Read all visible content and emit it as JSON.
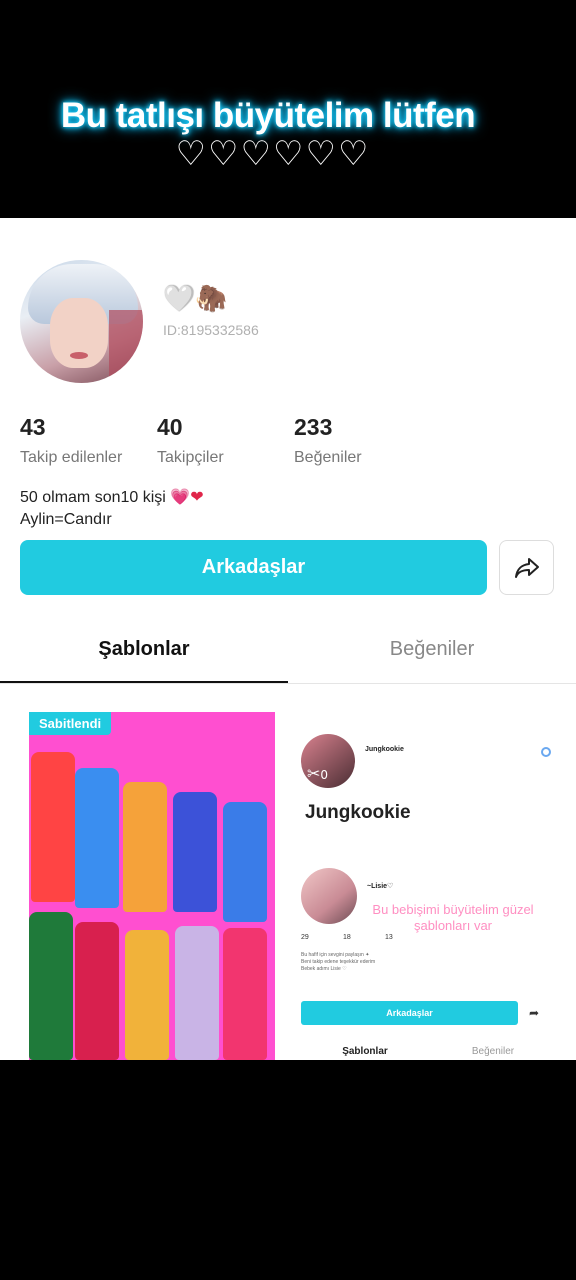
{
  "overlay_caption": {
    "line1": "Bu tatlışı  büyütelim lütfen",
    "line2": "♡♡♡♡♡♡"
  },
  "profile": {
    "name_emoji_heart": "🤍",
    "name_emoji_mammoth": "🦣",
    "user_id": "ID:8195332586",
    "stats": [
      {
        "value": "43",
        "label": "Takip edilenler"
      },
      {
        "value": "40",
        "label": "Takipçiler"
      },
      {
        "value": "233",
        "label": "Beğeniler"
      }
    ],
    "bio_line1": "50 olmam son10 kişi",
    "bio_hearts_pink": "💗",
    "bio_hearts_red": "❤",
    "bio_line2": "Aylin=Candır",
    "friends_button": "Arkadaşlar",
    "share_icon": "share-arrow-icon"
  },
  "tabs": {
    "templates": "Şablonlar",
    "likes": "Beğeniler"
  },
  "cards": {
    "pinned_badge": "Sabitlendi",
    "card2": {
      "small_name": "Jungkookie",
      "title": "Jungkookie",
      "scissors_count": "0",
      "second_name": "~Lisie♡",
      "pink_text": "Bu bebişimi büyütelim güzel şablonları var",
      "stats": [
        "29",
        "18",
        "13"
      ],
      "bio": "Bu hafif için sevgini paylaşın ✦\nBeni takip edene teşekkür ederim\nBebek adımı Lisie ♡",
      "button": "Arkadaşlar",
      "tab1": "Şablonlar",
      "tab2": "Beğeniler"
    }
  },
  "colors": {
    "accent": "#21cbe0",
    "caption_glow": "#1ad0ff"
  }
}
